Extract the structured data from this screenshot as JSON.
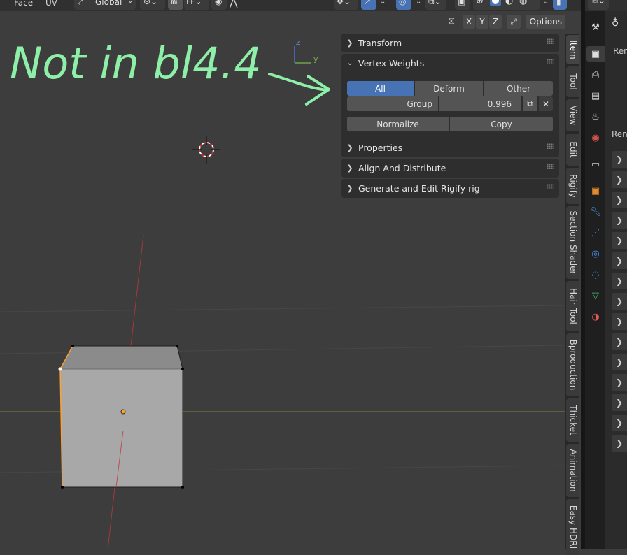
{
  "header": {
    "face": "Face",
    "uv": "UV",
    "orientation": "Global",
    "orientation_icon": "transform-orientation-icon",
    "options": "Options",
    "axis_x": "X",
    "axis_y": "Y",
    "axis_z": "Z"
  },
  "annotation": {
    "text": "Not in bl4.4",
    "color": "#8ef0a8"
  },
  "gizmo": {
    "z": "z",
    "y": "y"
  },
  "npanel": {
    "transform": "Transform",
    "vertex_weights": "Vertex Weights",
    "seg_all": "All",
    "seg_deform": "Deform",
    "seg_other": "Other",
    "group_label": "Group",
    "group_value": "0.996",
    "normalize": "Normalize",
    "copy": "Copy",
    "properties": "Properties",
    "align": "Align And Distribute",
    "rigify": "Generate and Edit Rigify rig"
  },
  "vtabs": [
    "Item",
    "Tool",
    "View",
    "Edit",
    "Rigify",
    "Section Shader",
    "Hair Tool",
    "Bproduction",
    "Thicket",
    "Animation",
    "Easy HDRI"
  ],
  "props": {
    "ren1": "Ren",
    "ren2": "Ren",
    "rows": 15
  },
  "colors": {
    "accent": "#4772b3",
    "selection": "#ffa030",
    "x_axis": "#c34747",
    "y_axis": "#6b9a3a"
  }
}
